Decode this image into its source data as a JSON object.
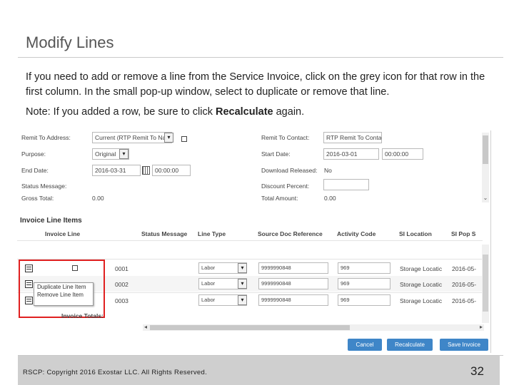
{
  "slide": {
    "title": "Modify Lines",
    "body": "If you need to add or remove a line from the Service Invoice, click on the grey icon for that row in the first column.  In the small pop-up window, select to duplicate or remove that line.",
    "note_prefix": "Note:  If you added a row, be sure to click ",
    "note_bold": "Recalculate",
    "note_suffix": " again.",
    "footer": "RSCP:  Copyright 2016 Exostar LLC. All Rights Reserved.",
    "page_number": "32"
  },
  "form": {
    "remit_to_address_label": "Remit To Address:",
    "remit_to_address_value": "Current (RTP Remit To Nan",
    "purpose_label": "Purpose:",
    "purpose_value": "Original",
    "end_date_label": "End Date:",
    "end_date_value": "2016-03-31",
    "end_time_value": "00:00:00",
    "status_message_label": "Status Message:",
    "gross_total_label": "Gross Total:",
    "gross_total_value": "0.00",
    "remit_to_contact_label": "Remit To Contact:",
    "remit_to_contact_value": "RTP Remit To Conta",
    "start_date_label": "Start Date:",
    "start_date_value": "2016-03-01",
    "start_time_value": "00:00:00",
    "download_released_label": "Download Released:",
    "download_released_value": "No",
    "discount_percent_label": "Discount Percent:",
    "total_amount_label": "Total Amount:",
    "total_amount_value": "0.00"
  },
  "table": {
    "section_title": "Invoice Line Items",
    "headers": [
      "Invoice Line",
      "Status Message",
      "Line Type",
      "Source Doc Reference",
      "Activity Code",
      "SI Location",
      "SI Pop S"
    ],
    "rows": [
      {
        "line": "0001",
        "type": "Labor",
        "source": "9999990848",
        "activity": "969",
        "location": "Storage Locatic",
        "pop": "2016-05-"
      },
      {
        "line": "0002",
        "type": "Labor",
        "source": "9999990848",
        "activity": "969",
        "location": "Storage Locatic",
        "pop": "2016-05-"
      },
      {
        "line": "0003",
        "type": "Labor",
        "source": "9999990848",
        "activity": "969",
        "location": "Storage Locatic",
        "pop": "2016-05-"
      }
    ],
    "totals_label": "Invoice Totals:",
    "popup": {
      "duplicate": "Duplicate Line Item",
      "remove": "Remove Line Item"
    }
  },
  "buttons": {
    "cancel": "Cancel",
    "recalculate": "Recalculate",
    "save": "Save Invoice"
  },
  "colors": {
    "highlight": "#e02020",
    "button": "#3f86c8"
  }
}
